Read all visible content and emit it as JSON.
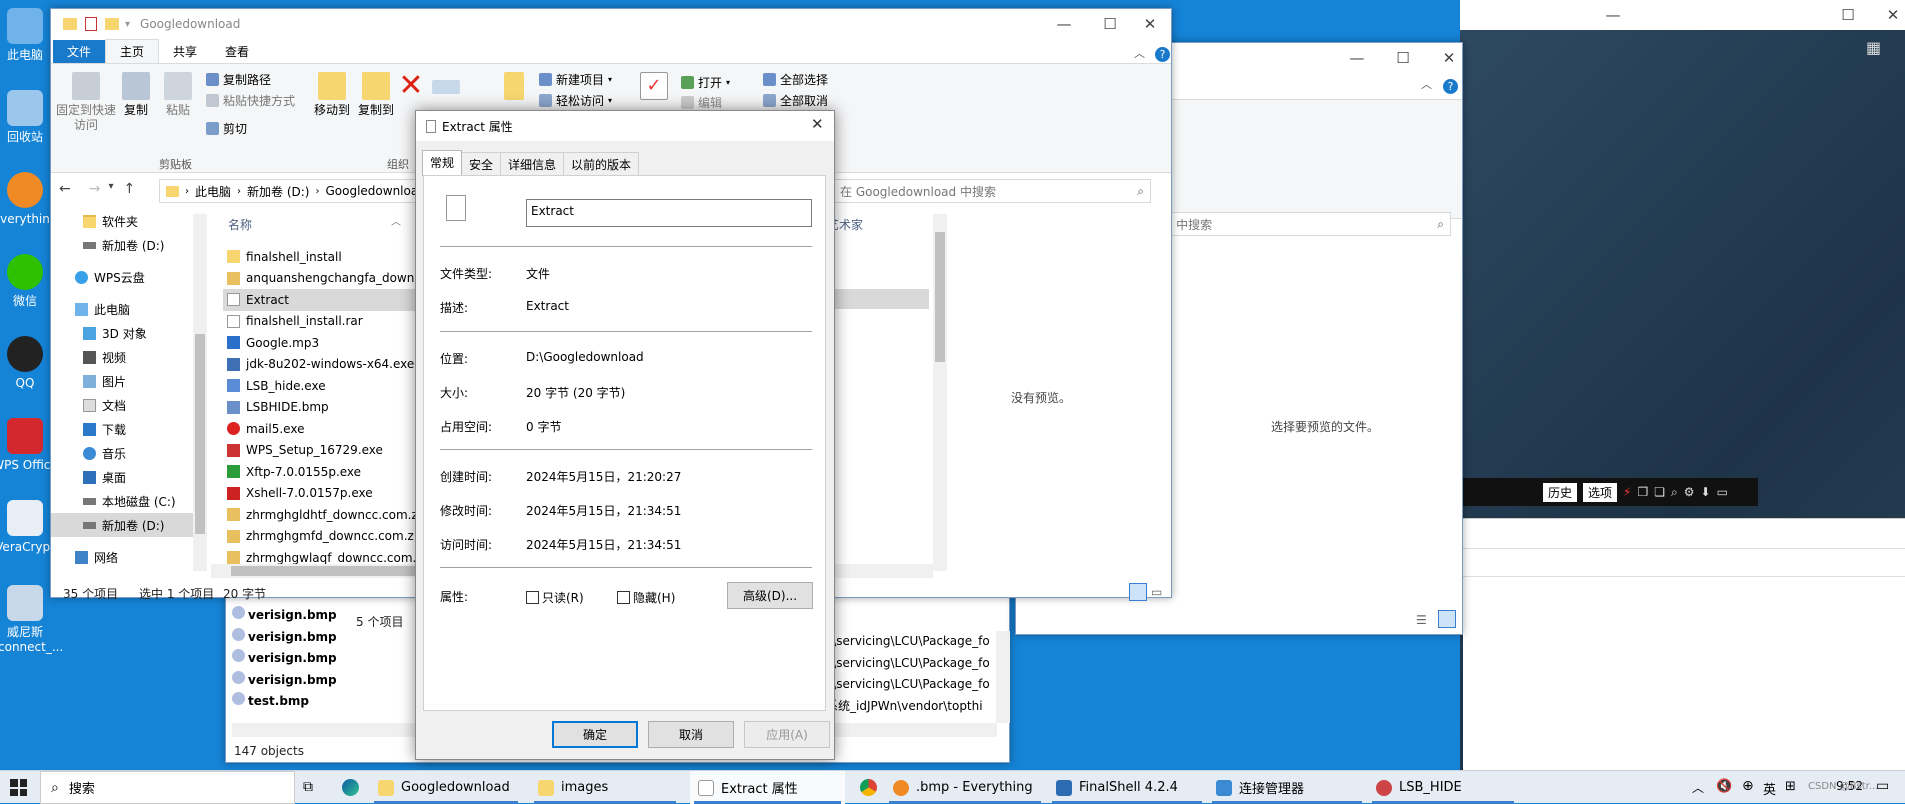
{
  "desktop": {
    "icons": [
      {
        "label": "此电脑"
      },
      {
        "label": "回收站"
      },
      {
        "label": "Everything"
      },
      {
        "label": "微信"
      },
      {
        "label": "QQ"
      },
      {
        "label": "WPS Office"
      },
      {
        "label": "VeraCrypt"
      },
      {
        "label": "威尼斯_connect_..."
      }
    ]
  },
  "explorer_main": {
    "title": "Googledownload",
    "ribbon_tabs": [
      "文件",
      "主页",
      "共享",
      "查看"
    ],
    "ribbon": {
      "pin": "固定到快速访问",
      "copy": "复制",
      "paste": "粘贴",
      "copy_path": "复制路径",
      "paste_shortcut": "粘贴快捷方式",
      "cut": "剪切",
      "clipboard_group": "剪贴板",
      "move_to": "移动到",
      "copy_to": "复制到",
      "organize_group": "组织",
      "new_item": "新建项目",
      "easy_access": "轻松访问",
      "open": "打开",
      "edit": "编辑",
      "select_all": "全部选择",
      "select_none": "全部取消"
    },
    "address": {
      "crumbs": [
        "此电脑",
        "新加卷 (D:)",
        "Googledownload"
      ],
      "search_placeholder": "在 Googledownload 中搜索"
    },
    "nav": [
      {
        "label": "软件夹",
        "icon": "folder-icon"
      },
      {
        "label": "新加卷 (D:)",
        "icon": "drive-icon"
      },
      {
        "label": "WPS云盘",
        "icon": "cloud-icon"
      },
      {
        "label": "此电脑",
        "icon": "pc-icon"
      },
      {
        "label": "3D 对象",
        "icon": "3d-icon"
      },
      {
        "label": "视频",
        "icon": "video-icon"
      },
      {
        "label": "图片",
        "icon": "picture-icon"
      },
      {
        "label": "文档",
        "icon": "document-icon"
      },
      {
        "label": "下载",
        "icon": "download-icon"
      },
      {
        "label": "音乐",
        "icon": "music-icon"
      },
      {
        "label": "桌面",
        "icon": "desktop-icon"
      },
      {
        "label": "本地磁盘 (C:)",
        "icon": "drive-icon"
      },
      {
        "label": "新加卷 (D:)",
        "icon": "drive-icon"
      },
      {
        "label": "网络",
        "icon": "network-icon"
      }
    ],
    "column_name": "名称",
    "files": [
      {
        "name": "finalshell_install",
        "color": "#f7d56f"
      },
      {
        "name": "anquanshengchangfa_downcc",
        "color": "#e8c060"
      },
      {
        "name": "Extract",
        "color": "#ffffff"
      },
      {
        "name": "finalshell_install.rar",
        "color": "#ffffff"
      },
      {
        "name": "Google.mp3",
        "color": "#2a6fc9"
      },
      {
        "name": "jdk-8u202-windows-x64.exe",
        "color": "#3f6fb5"
      },
      {
        "name": "LSB_hide.exe",
        "color": "#5a8dd6"
      },
      {
        "name": "LSBHIDE.bmp",
        "color": "#6b8fc9"
      },
      {
        "name": "mail5.exe",
        "color": "#d22"
      },
      {
        "name": "WPS_Setup_16729.exe",
        "color": "#c33"
      },
      {
        "name": "Xftp-7.0.0155p.exe",
        "color": "#2a9d3a"
      },
      {
        "name": "Xshell-7.0.0157p.exe",
        "color": "#c22"
      },
      {
        "name": "zhrmghgldhtf_downcc.com.zip",
        "color": "#e8c060"
      },
      {
        "name": "zhrmghgmfd_downcc.com.zip",
        "color": "#e8c060"
      },
      {
        "name": "zhrmghgwlaqf_downcc.com.zip",
        "color": "#e8c060"
      }
    ],
    "status_count": "35 个项目",
    "status_sel": "选中 1 个项目",
    "status_size": "20 字节",
    "partial_col": "艺术家"
  },
  "explorer_second": {
    "search_placeholder": "s 中搜索",
    "no_preview": "没有预览。",
    "select_preview": "选择要预览的文件。",
    "status": "5 个项目"
  },
  "everything": {
    "files": [
      "verisign.bmp",
      "verisign.bmp",
      "verisign.bmp",
      "verisign.bmp",
      "test.bmp"
    ],
    "paths": [
      "s\\servicing\\LCU\\Package_fo",
      "s\\servicing\\LCU\\Package_fo",
      "s\\servicing\\LCU\\Package_fo",
      "系统_idJPWn\\vendor\\topthi"
    ],
    "status": "147 objects"
  },
  "finalshell_toolbar": {
    "history": "历史",
    "options": "选项"
  },
  "dialog": {
    "title": "Extract 属性",
    "tabs": [
      "常规",
      "安全",
      "详细信息",
      "以前的版本"
    ],
    "name_value": "Extract",
    "rows": {
      "type_k": "文件类型:",
      "type_v": "文件",
      "desc_k": "描述:",
      "desc_v": "Extract",
      "loc_k": "位置:",
      "loc_v": "D:\\Googledownload",
      "size_k": "大小:",
      "size_v": "20 字节 (20 字节)",
      "disk_k": "占用空间:",
      "disk_v": "0 字节",
      "created_k": "创建时间:",
      "created_v": "2024年5月15日，21:20:27",
      "modified_k": "修改时间:",
      "modified_v": "2024年5月15日，21:34:51",
      "accessed_k": "访问时间:",
      "accessed_v": "2024年5月15日，21:34:51",
      "attr_k": "属性:"
    },
    "readonly": "只读(R)",
    "hidden": "隐藏(H)",
    "advanced": "高级(D)...",
    "ok": "确定",
    "cancel": "取消",
    "apply": "应用(A)"
  },
  "taskbar": {
    "search": "搜索",
    "items": [
      "Googledownload",
      "images",
      "Extract 属性",
      ".bmp - Everything",
      "FinalShell 4.2.4",
      "连接管理器",
      "LSB_HIDE"
    ],
    "tray_lang": "英",
    "time": "9:52",
    "watermark": "CSDN @Bstr..."
  }
}
